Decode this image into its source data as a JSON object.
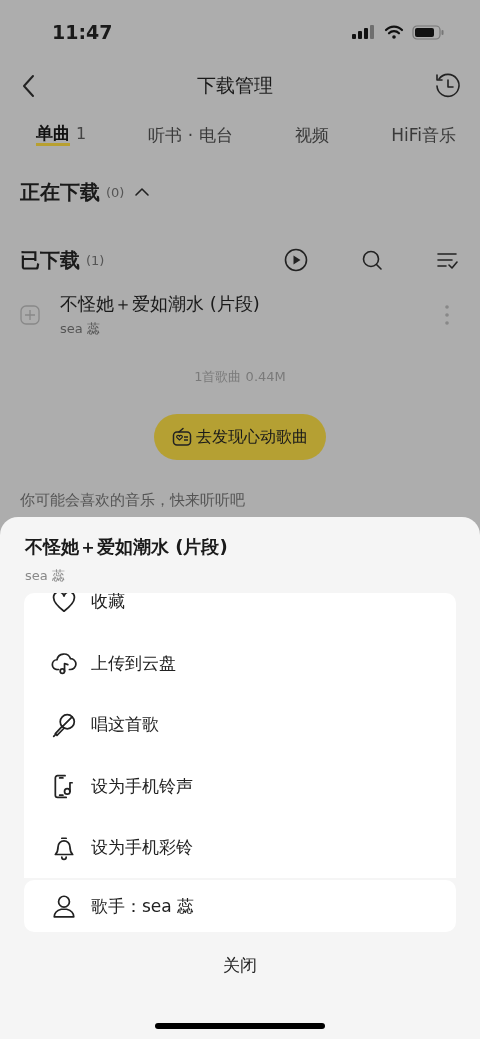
{
  "status_bar": {
    "time": "11:47"
  },
  "header": {
    "title": "下载管理"
  },
  "tabs": [
    {
      "label": "单曲",
      "count": "1",
      "selected": true
    },
    {
      "label": "听书 · 电台",
      "selected": false
    },
    {
      "label": "视频",
      "selected": false
    },
    {
      "label": "HiFi音乐",
      "selected": false
    }
  ],
  "downloading": {
    "title": "正在下载",
    "count": "(0)",
    "expanded": true
  },
  "downloaded": {
    "title": "已下载",
    "count": "(1)"
  },
  "songs": [
    {
      "title": "不怪她＋爱如潮水 (片段)",
      "artist": "sea 蕊"
    }
  ],
  "summary": "1首歌曲 0.44M",
  "discover_button": "去发现心动歌曲",
  "recommend_text": "你可能会喜欢的音乐，快来听听吧",
  "sheet": {
    "title": "不怪她＋爱如潮水 (片段)",
    "subtitle": "sea 蕊",
    "actions": [
      {
        "kind": "heart",
        "label": "收藏"
      },
      {
        "kind": "cloud",
        "label": "上传到云盘"
      },
      {
        "kind": "mic",
        "label": "唱这首歌"
      },
      {
        "kind": "phone",
        "label": "设为手机铃声"
      },
      {
        "kind": "bell",
        "label": "设为手机彩铃"
      }
    ],
    "artist_action": {
      "label": "歌手：sea 蕊"
    },
    "close": "关闭"
  }
}
